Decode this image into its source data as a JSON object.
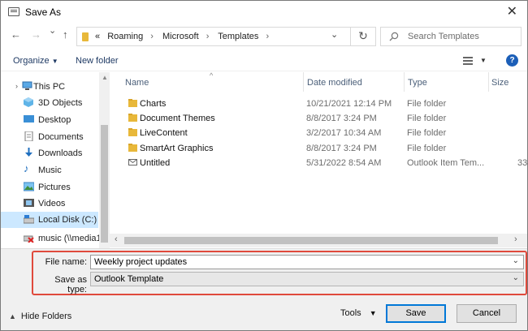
{
  "window": {
    "title": "Save As",
    "close_glyph": "✕"
  },
  "nav": {
    "back_glyph": "←",
    "forward_glyph": "→",
    "recent_glyph": "⌄",
    "up_glyph": "↑"
  },
  "address": {
    "overflow_glyph": "«",
    "crumbs": [
      "Roaming",
      "Microsoft",
      "Templates"
    ],
    "sep_glyph": "›",
    "refresh_glyph": "↻"
  },
  "search": {
    "placeholder": "Search Templates",
    "icon": "search-icon"
  },
  "toolbar": {
    "organize": "Organize",
    "new_folder": "New folder",
    "help": "?"
  },
  "sidebar": {
    "items": [
      {
        "label": "This PC",
        "icon": "pc-icon"
      },
      {
        "label": "3D Objects",
        "icon": "cube-icon"
      },
      {
        "label": "Desktop",
        "icon": "desktop-icon"
      },
      {
        "label": "Documents",
        "icon": "documents-icon"
      },
      {
        "label": "Downloads",
        "icon": "download-icon"
      },
      {
        "label": "Music",
        "icon": "music-icon"
      },
      {
        "label": "Pictures",
        "icon": "pictures-icon"
      },
      {
        "label": "Videos",
        "icon": "videos-icon"
      },
      {
        "label": "Local Disk (C:)",
        "icon": "drive-icon"
      },
      {
        "label": "music (\\\\media1",
        "icon": "network-drive-disconnected-icon"
      }
    ]
  },
  "columns": {
    "name": "Name",
    "date": "Date modified",
    "type": "Type",
    "size": "Size"
  },
  "files": [
    {
      "name": "Charts",
      "date": "10/21/2021 12:14 PM",
      "type": "File folder",
      "size": "",
      "icon": "folder-icon"
    },
    {
      "name": "Document Themes",
      "date": "8/8/2017 3:24 PM",
      "type": "File folder",
      "size": "",
      "icon": "folder-icon"
    },
    {
      "name": "LiveContent",
      "date": "3/2/2017 10:34 AM",
      "type": "File folder",
      "size": "",
      "icon": "folder-icon"
    },
    {
      "name": "SmartArt Graphics",
      "date": "8/8/2017 3:24 PM",
      "type": "File folder",
      "size": "",
      "icon": "folder-icon"
    },
    {
      "name": "Untitled",
      "date": "5/31/2022 8:54 AM",
      "type": "Outlook Item Tem...",
      "size": "33",
      "icon": "envelope-icon"
    }
  ],
  "form": {
    "file_name_label": "File name:",
    "file_name_value": "Weekly project updates",
    "save_type_label": "Save as type:",
    "save_type_value": "Outlook Template",
    "chevron_glyph": "⌄"
  },
  "footer": {
    "hide_folders": "Hide Folders",
    "tools": "Tools",
    "save": "Save",
    "cancel": "Cancel"
  },
  "colors": {
    "accent": "#0078d7",
    "highlight_border": "#e04a3c",
    "folder": "#e8b83a",
    "selection": "#cce8ff"
  }
}
